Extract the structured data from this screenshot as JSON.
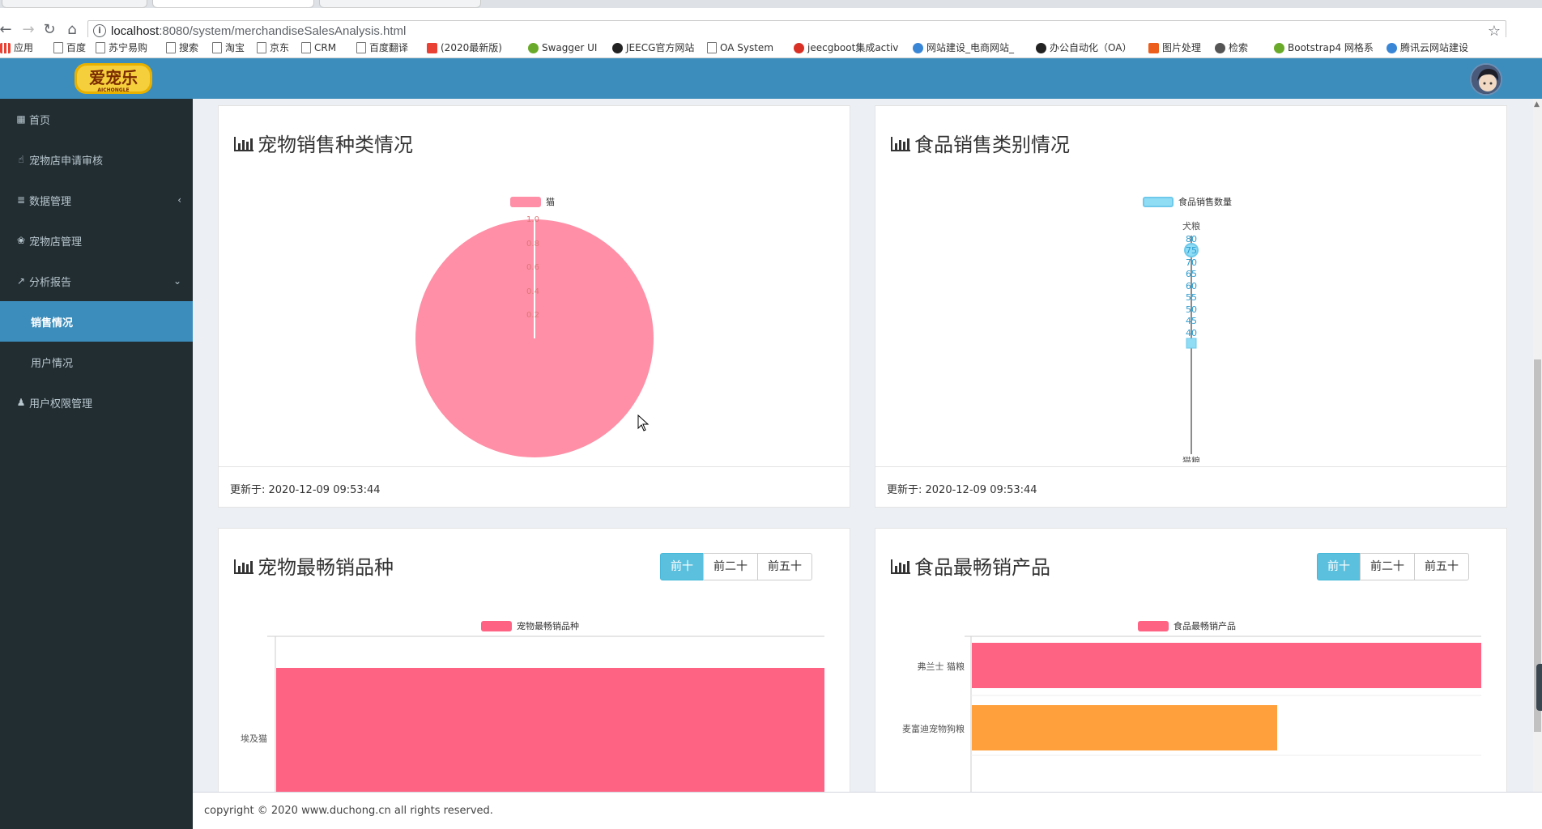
{
  "browser": {
    "url_host": "localhost",
    "url_path": ":8080/system/merchandiseSalesAnalysis.html",
    "bookmarks": [
      {
        "label": "应用",
        "icon": "apps-grid-icon"
      },
      {
        "label": "百度",
        "icon": "page-icon"
      },
      {
        "label": "苏宁易购",
        "icon": "page-icon"
      },
      {
        "label": "搜索",
        "icon": "page-icon"
      },
      {
        "label": "淘宝",
        "icon": "page-icon"
      },
      {
        "label": "京东",
        "icon": "page-icon"
      },
      {
        "label": "CRM",
        "icon": "page-icon"
      },
      {
        "label": "百度翻译",
        "icon": "page-icon"
      },
      {
        "label": "(2020最新版)",
        "icon": "c-logo-icon"
      },
      {
        "label": "Swagger UI",
        "icon": "swagger-icon"
      },
      {
        "label": "JEECG官方网站",
        "icon": "jeecg-icon"
      },
      {
        "label": "OA System",
        "icon": "page-icon"
      },
      {
        "label": "jeecgboot集成activ",
        "icon": "g-logo-icon"
      },
      {
        "label": "网站建设_电商网站_",
        "icon": "cloud-icon"
      },
      {
        "label": "办公自动化（OA）",
        "icon": "github-icon"
      },
      {
        "label": "图片处理",
        "icon": "office-icon"
      },
      {
        "label": "检索",
        "icon": "search-doc-icon"
      },
      {
        "label": "Bootstrap4 网格系",
        "icon": "runoob-icon"
      },
      {
        "label": "腾讯云网站建设",
        "icon": "tencent-cloud-icon"
      }
    ]
  },
  "sidebar": {
    "items": [
      {
        "label": "首页",
        "icon": "th-large-icon"
      },
      {
        "label": "宠物店申请审核",
        "icon": "hand-pointer-icon"
      },
      {
        "label": "数据管理",
        "icon": "database-icon"
      },
      {
        "label": "宠物店管理",
        "icon": "paw-icon"
      },
      {
        "label": "分析报告",
        "icon": "line-chart-icon"
      },
      {
        "label": "销售情况",
        "icon": ""
      },
      {
        "label": "用户情况",
        "icon": ""
      },
      {
        "label": "用户权限管理",
        "icon": "user-icon"
      }
    ]
  },
  "panels": {
    "pet_category": {
      "title": "宠物销售种类情况",
      "footer": "更新于: 2020-12-09 09:53:44"
    },
    "food_category": {
      "title": "食品销售类别情况",
      "footer": "更新于: 2020-12-09 09:53:44"
    },
    "pet_best": {
      "title": "宠物最畅销品种",
      "buttons": [
        "前十",
        "前二十",
        "前五十"
      ]
    },
    "food_best": {
      "title": "食品最畅销产品",
      "buttons": [
        "前十",
        "前二十",
        "前五十"
      ]
    }
  },
  "chart_data": [
    {
      "type": "pie",
      "legend": [
        "猫"
      ],
      "slices": [
        {
          "name": "猫",
          "value": 1.0
        }
      ],
      "radial_ticks": [
        "1.0",
        "0.8",
        "0.6",
        "0.4",
        "0.2"
      ],
      "colors": [
        "#ff8fa6"
      ]
    },
    {
      "type": "radar",
      "legend": [
        "食品销售数量"
      ],
      "indicators": [
        "犬粮",
        "猫粮"
      ],
      "radial_ticks": [
        "80",
        "75",
        "70",
        "65",
        "60",
        "55",
        "50",
        "45",
        "40"
      ],
      "colors": [
        "#7fd4f0"
      ]
    },
    {
      "type": "bar",
      "orientation": "horizontal",
      "legend": [
        "宠物最畅销品种"
      ],
      "categories": [
        "埃及猫"
      ],
      "colors": [
        "#ff6384"
      ]
    },
    {
      "type": "bar",
      "orientation": "horizontal",
      "legend": [
        "食品最畅销产品"
      ],
      "categories": [
        "弗兰士 猫粮",
        "麦富迪宠物狗粮"
      ],
      "values": [
        1.0,
        0.6
      ],
      "colors": [
        "#ff6384",
        "#ffa03c"
      ]
    }
  ],
  "footer": {
    "copyright": "copyright © 2020 www.duchong.cn all rights reserved."
  }
}
